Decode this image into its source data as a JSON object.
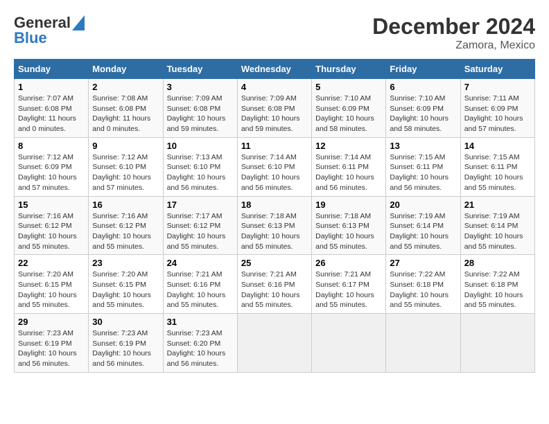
{
  "logo": {
    "line1": "General",
    "line2": "Blue"
  },
  "header": {
    "month": "December 2024",
    "location": "Zamora, Mexico"
  },
  "weekdays": [
    "Sunday",
    "Monday",
    "Tuesday",
    "Wednesday",
    "Thursday",
    "Friday",
    "Saturday"
  ],
  "weeks": [
    [
      {
        "day": "1",
        "sunrise": "7:07 AM",
        "sunset": "6:08 PM",
        "daylight": "11 hours and 0 minutes."
      },
      {
        "day": "2",
        "sunrise": "7:08 AM",
        "sunset": "6:08 PM",
        "daylight": "11 hours and 0 minutes."
      },
      {
        "day": "3",
        "sunrise": "7:09 AM",
        "sunset": "6:08 PM",
        "daylight": "10 hours and 59 minutes."
      },
      {
        "day": "4",
        "sunrise": "7:09 AM",
        "sunset": "6:08 PM",
        "daylight": "10 hours and 59 minutes."
      },
      {
        "day": "5",
        "sunrise": "7:10 AM",
        "sunset": "6:09 PM",
        "daylight": "10 hours and 58 minutes."
      },
      {
        "day": "6",
        "sunrise": "7:10 AM",
        "sunset": "6:09 PM",
        "daylight": "10 hours and 58 minutes."
      },
      {
        "day": "7",
        "sunrise": "7:11 AM",
        "sunset": "6:09 PM",
        "daylight": "10 hours and 57 minutes."
      }
    ],
    [
      {
        "day": "8",
        "sunrise": "7:12 AM",
        "sunset": "6:09 PM",
        "daylight": "10 hours and 57 minutes."
      },
      {
        "day": "9",
        "sunrise": "7:12 AM",
        "sunset": "6:10 PM",
        "daylight": "10 hours and 57 minutes."
      },
      {
        "day": "10",
        "sunrise": "7:13 AM",
        "sunset": "6:10 PM",
        "daylight": "10 hours and 56 minutes."
      },
      {
        "day": "11",
        "sunrise": "7:14 AM",
        "sunset": "6:10 PM",
        "daylight": "10 hours and 56 minutes."
      },
      {
        "day": "12",
        "sunrise": "7:14 AM",
        "sunset": "6:11 PM",
        "daylight": "10 hours and 56 minutes."
      },
      {
        "day": "13",
        "sunrise": "7:15 AM",
        "sunset": "6:11 PM",
        "daylight": "10 hours and 56 minutes."
      },
      {
        "day": "14",
        "sunrise": "7:15 AM",
        "sunset": "6:11 PM",
        "daylight": "10 hours and 55 minutes."
      }
    ],
    [
      {
        "day": "15",
        "sunrise": "7:16 AM",
        "sunset": "6:12 PM",
        "daylight": "10 hours and 55 minutes."
      },
      {
        "day": "16",
        "sunrise": "7:16 AM",
        "sunset": "6:12 PM",
        "daylight": "10 hours and 55 minutes."
      },
      {
        "day": "17",
        "sunrise": "7:17 AM",
        "sunset": "6:12 PM",
        "daylight": "10 hours and 55 minutes."
      },
      {
        "day": "18",
        "sunrise": "7:18 AM",
        "sunset": "6:13 PM",
        "daylight": "10 hours and 55 minutes."
      },
      {
        "day": "19",
        "sunrise": "7:18 AM",
        "sunset": "6:13 PM",
        "daylight": "10 hours and 55 minutes."
      },
      {
        "day": "20",
        "sunrise": "7:19 AM",
        "sunset": "6:14 PM",
        "daylight": "10 hours and 55 minutes."
      },
      {
        "day": "21",
        "sunrise": "7:19 AM",
        "sunset": "6:14 PM",
        "daylight": "10 hours and 55 minutes."
      }
    ],
    [
      {
        "day": "22",
        "sunrise": "7:20 AM",
        "sunset": "6:15 PM",
        "daylight": "10 hours and 55 minutes."
      },
      {
        "day": "23",
        "sunrise": "7:20 AM",
        "sunset": "6:15 PM",
        "daylight": "10 hours and 55 minutes."
      },
      {
        "day": "24",
        "sunrise": "7:21 AM",
        "sunset": "6:16 PM",
        "daylight": "10 hours and 55 minutes."
      },
      {
        "day": "25",
        "sunrise": "7:21 AM",
        "sunset": "6:16 PM",
        "daylight": "10 hours and 55 minutes."
      },
      {
        "day": "26",
        "sunrise": "7:21 AM",
        "sunset": "6:17 PM",
        "daylight": "10 hours and 55 minutes."
      },
      {
        "day": "27",
        "sunrise": "7:22 AM",
        "sunset": "6:18 PM",
        "daylight": "10 hours and 55 minutes."
      },
      {
        "day": "28",
        "sunrise": "7:22 AM",
        "sunset": "6:18 PM",
        "daylight": "10 hours and 55 minutes."
      }
    ],
    [
      {
        "day": "29",
        "sunrise": "7:23 AM",
        "sunset": "6:19 PM",
        "daylight": "10 hours and 56 minutes."
      },
      {
        "day": "30",
        "sunrise": "7:23 AM",
        "sunset": "6:19 PM",
        "daylight": "10 hours and 56 minutes."
      },
      {
        "day": "31",
        "sunrise": "7:23 AM",
        "sunset": "6:20 PM",
        "daylight": "10 hours and 56 minutes."
      },
      null,
      null,
      null,
      null
    ]
  ]
}
